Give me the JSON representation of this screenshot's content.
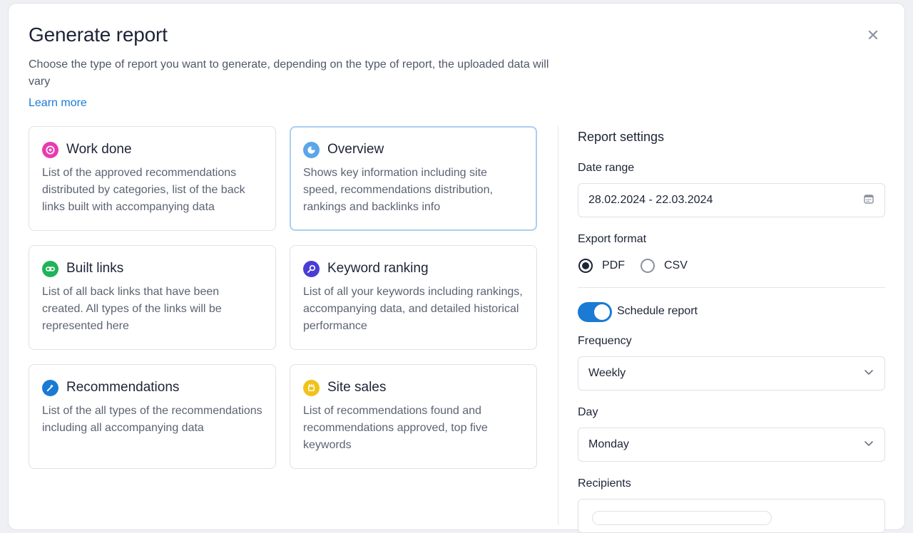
{
  "dialog": {
    "title": "Generate report",
    "subtitle": "Choose the type of report you want to generate, depending on the type of report, the uploaded data will vary",
    "learn_more": "Learn more",
    "close_icon": "close-icon"
  },
  "report_types": [
    {
      "title": "Work done",
      "desc": "List of the approved recommendations distributed by categories, list of the back links built with accompanying data",
      "icon": "work-done-icon",
      "color": "#e83bb0",
      "selected": false
    },
    {
      "title": "Overview",
      "desc": "Shows key information including site speed, recommendations distribution, rankings and backlinks info",
      "icon": "overview-icon",
      "color": "#5aa6e8",
      "selected": true
    },
    {
      "title": "Built links",
      "desc": " List of all back links that have been created. All types of the links will be represented here",
      "icon": "link-icon",
      "color": "#1fb35a",
      "selected": false
    },
    {
      "title": "Keyword ranking",
      "desc": "List of all your keywords including rankings, accompanying data, and detailed historical performance",
      "icon": "keyword-icon",
      "color": "#4a3cd6",
      "selected": false
    },
    {
      "title": "Recommendations",
      "desc": "List of the all types of the recommendations including all accompanying data",
      "icon": "recommendations-icon",
      "color": "#1a7ad4",
      "selected": false
    },
    {
      "title": "Site sales",
      "desc": "List of recommendations found and recommendations approved, top five keywords",
      "icon": "site-sales-icon",
      "color": "#f2c21b",
      "selected": false
    }
  ],
  "settings": {
    "title": "Report settings",
    "date_range_label": "Date range",
    "date_range_value": "28.02.2024 - 22.03.2024",
    "export_label": "Export format",
    "export_options": [
      "PDF",
      "CSV"
    ],
    "export_selected": "PDF",
    "schedule_label": "Schedule report",
    "schedule_on": true,
    "frequency_label": "Frequency",
    "frequency_value": "Weekly",
    "day_label": "Day",
    "day_value": "Monday",
    "recipients_label": "Recipients"
  },
  "colors": {
    "accent": "#1a7ad4",
    "selected_border": "#a9cff3"
  }
}
